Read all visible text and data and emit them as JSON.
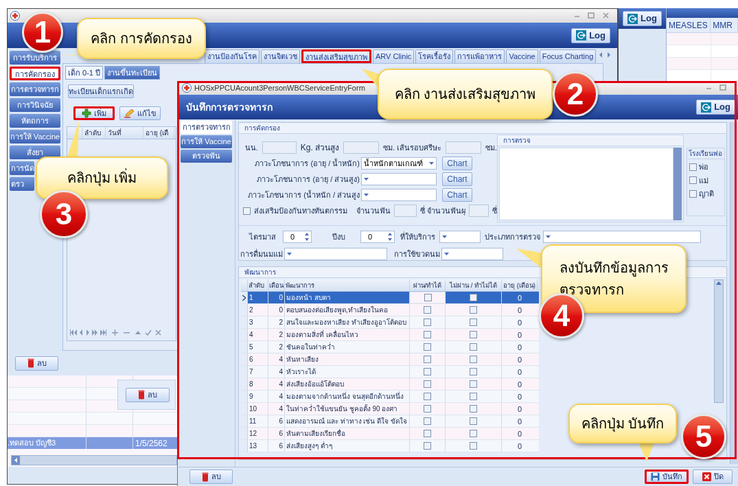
{
  "main_window": {
    "log_button": "Log",
    "sidebar": [
      {
        "label": "การรับบริการ",
        "selected": false,
        "highlighted": false
      },
      {
        "label": "การคัดกรอง",
        "selected": true,
        "highlighted": true
      },
      {
        "label": "การตรวจทารก",
        "selected": false,
        "highlighted": false
      },
      {
        "label": "การวินิจฉัย",
        "selected": false,
        "highlighted": false
      },
      {
        "label": "หัตถการ",
        "selected": false,
        "highlighted": false
      },
      {
        "label": "การให้ Vaccine",
        "selected": false,
        "highlighted": false
      },
      {
        "label": "สั่งยา",
        "selected": false,
        "highlighted": false
      },
      {
        "label": "การนัด",
        "selected": false,
        "highlighted": false
      },
      {
        "label": "ตรว",
        "selected": false,
        "highlighted": false
      }
    ],
    "tabs": [
      {
        "label": "งานป้องกันโรค",
        "highlighted": false
      },
      {
        "label": "งานจิตเวช",
        "highlighted": false
      },
      {
        "label": "งานส่งเสริมสุขภาพ",
        "highlighted": true
      },
      {
        "label": "ARV Clinic",
        "highlighted": false
      },
      {
        "label": "โรคเรื้อรัง",
        "highlighted": false
      },
      {
        "label": "การแพ้อาหาร",
        "highlighted": false
      },
      {
        "label": "Vaccine",
        "highlighted": false
      },
      {
        "label": "Focus Charting",
        "highlighted": false
      }
    ],
    "subtabs": [
      {
        "label": "เด็ก 0-1 ปี",
        "selected": true
      },
      {
        "label": "งานขึ้นทะเบียน",
        "selected": false
      }
    ],
    "register_button": "ทะเบียนเด็กแรกเกิด",
    "actions": [
      {
        "kind": "add",
        "label": "เพิ่ม",
        "highlighted": true
      },
      {
        "kind": "edit",
        "label": "แก้ไข",
        "highlighted": false
      }
    ],
    "visit_grid": {
      "columns": [
        "ลำดับ",
        "วันที่",
        "อายุ (เดื"
      ]
    },
    "delete_button": "ลบ",
    "history_grid": {
      "rows": [
        {
          "cells": [
            ".ทดสอบ บัญชี3",
            "1/5/2562"
          ],
          "selected": true
        }
      ]
    },
    "overlay_delete_button": "ลบ"
  },
  "side_window": {
    "log_button": "Log"
  },
  "vaccine_window": {
    "columns": [
      "MEASLES",
      "MMR"
    ]
  },
  "form": {
    "title": "HOSxPPCUAcount3PersonWBCServiceEntryForm",
    "heading": "บันทึกการตรวจทารก",
    "log_button": "Log",
    "highlighted": true,
    "nav": [
      {
        "label": "การตรวจทารก",
        "selected": true
      },
      {
        "label": "การให้ Vaccine",
        "selected": false
      },
      {
        "label": "ตรวจฟัน",
        "selected": false
      }
    ],
    "screening": {
      "title": "การคัดกรอง",
      "weight_label": "นน.",
      "height_label": "Kg. ส่วนสูง",
      "head_label": "ซม. เส้นรอบศรีษะ",
      "head_unit": "ซม.",
      "nutrition": [
        {
          "label": "ภาวะโภชนาการ (อายุ / น้ำหนัก)",
          "value": "น้ำหนักตามเกณฑ์",
          "button": "Chart"
        },
        {
          "label": "ภาวะโภชนาการ (อายุ / ส่วนสูง)",
          "button": "Chart"
        },
        {
          "label": "ภาวะโภชนาการ (น้ำหนัก / ส่วนสูง",
          "button": "Chart"
        }
      ],
      "dental": {
        "label": "ส่งเสริมป้องกันทางทันตกรรม",
        "checked": false
      },
      "teeth_label": "จำนวนฟัน",
      "decay_label": "ซี่ จำนวนฟันผุ",
      "decay_unit": "ซี่",
      "exam_title": "การตรวจ",
      "school": {
        "title": "โรงเรียนพ่อ",
        "options": [
          {
            "label": "พ่อ",
            "checked": false
          },
          {
            "label": "แม่",
            "checked": false
          },
          {
            "label": "ญาติ",
            "checked": false
          }
        ]
      },
      "trimester": {
        "label": "ไตรมาส",
        "value": "0"
      },
      "fiscal_year": {
        "label": "ปีงบ",
        "value": "0"
      },
      "place_label": "ที่ให้บริการ",
      "exam_type_label": "ประเภทการตรวจ",
      "breastfeeding_label": "การดื่มนมแม่",
      "bottle_label": "การใช้ขวดนม"
    },
    "development": {
      "title": "พัฒนาการ",
      "columns": [
        "ลำดับ",
        "เดือน",
        "พัฒนาการ",
        "ผ่าน/ทำได้",
        "ไม่ผ่าน / ทำไม่ได้",
        "อายุ (เดือน)"
      ],
      "rows": [
        {
          "no": "1",
          "month": "0",
          "item": "มองหน้า สบตา",
          "pass": false,
          "fail": false,
          "age": "0",
          "selected": true
        },
        {
          "no": "2",
          "month": "0",
          "item": "ตอบสนองต่อเสียงพูด,ทำเสียงในคอ",
          "pass": false,
          "fail": false,
          "age": "0",
          "selected": false
        },
        {
          "no": "3",
          "month": "2",
          "item": "สนใจและมองหาเสียง ทำเสียงอูอาโต้ตอบ",
          "pass": false,
          "fail": false,
          "age": "0",
          "selected": false
        },
        {
          "no": "4",
          "month": "2",
          "item": "มองตามสิ่งที่ เคลื่อนไหว",
          "pass": false,
          "fail": false,
          "age": "0",
          "selected": false
        },
        {
          "no": "5",
          "month": "2",
          "item": "ชันคอในท่าคว่ำ",
          "pass": false,
          "fail": false,
          "age": "0",
          "selected": false
        },
        {
          "no": "6",
          "month": "4",
          "item": "หันหาเสียง",
          "pass": false,
          "fail": false,
          "age": "0",
          "selected": false
        },
        {
          "no": "7",
          "month": "4",
          "item": "หัวเราะได้",
          "pass": false,
          "fail": false,
          "age": "0",
          "selected": false
        },
        {
          "no": "8",
          "month": "4",
          "item": "ส่งเสียงอ้อแอ้โต้ตอบ",
          "pass": false,
          "fail": false,
          "age": "0",
          "selected": false
        },
        {
          "no": "9",
          "month": "4",
          "item": "มองตามจากด้านหนึ่ง จนสุดอีกด้านหนึ่ง",
          "pass": false,
          "fail": false,
          "age": "0",
          "selected": false
        },
        {
          "no": "10",
          "month": "4",
          "item": "ในท่าคว่ำใช้แขนยัน ชูคอตั้ง 90 องศา",
          "pass": false,
          "fail": false,
          "age": "0",
          "selected": false
        },
        {
          "no": "11",
          "month": "6",
          "item": "แสดงอารมณ์ และ ท่าทาง เช่น ดีใจ ขัดใจ",
          "pass": false,
          "fail": false,
          "age": "0",
          "selected": false
        },
        {
          "no": "12",
          "month": "6",
          "item": "หันตามเสียงเรียกชื่อ",
          "pass": false,
          "fail": false,
          "age": "0",
          "selected": false
        },
        {
          "no": "13",
          "month": "6",
          "item": "ส่งเสียงสูงๆ ต่ำๆ",
          "pass": false,
          "fail": false,
          "age": "0",
          "selected": false
        }
      ]
    },
    "delete_button": "ลบ",
    "save_button": {
      "label": "บันทึก",
      "highlighted": true
    },
    "close_button": "ปิด"
  },
  "callouts": [
    {
      "number": "1",
      "lines": [
        "คลิก การคัดกรอง"
      ]
    },
    {
      "number": "2",
      "lines": [
        "คลิก งานส่งเสริมสุขภาพ"
      ]
    },
    {
      "number": "3",
      "lines": [
        "คลิกปุ่ม เพิ่ม"
      ]
    },
    {
      "number": "4",
      "lines": [
        "ลงบันทึกข้อมูลการ",
        "ตรวจทารก"
      ]
    },
    {
      "number": "5",
      "lines": [
        "คลิกปุ่ม บันทึก"
      ]
    }
  ]
}
